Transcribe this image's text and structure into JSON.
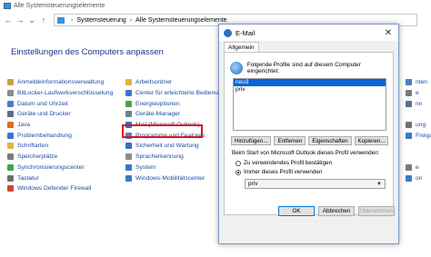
{
  "window": {
    "title": "Alle Systemsteuerungselemente"
  },
  "address": {
    "crumbs": [
      "Systemsteuerung",
      "Alle Systemsteuerungselemente"
    ]
  },
  "heading": "Einstellungen des Computers anpassen",
  "col1": [
    {
      "label": "Anmeldeinformationsverwaltung",
      "color": "#c9a23d"
    },
    {
      "label": "BitLocker-Laufwerkverschlüsselung",
      "color": "#8c8c8c"
    },
    {
      "label": "Datum und Uhrzeit",
      "color": "#4a7fc0"
    },
    {
      "label": "Geräte und Drucker",
      "color": "#5c6f84"
    },
    {
      "label": "Java",
      "color": "#d96f2a"
    },
    {
      "label": "Problembehandlung",
      "color": "#3a78c9"
    },
    {
      "label": "Schriftarten",
      "color": "#e0b640"
    },
    {
      "label": "Speicherplätze",
      "color": "#7a7a7a"
    },
    {
      "label": "Synchronisierungscenter",
      "color": "#3aa64a"
    },
    {
      "label": "Tastatur",
      "color": "#6f6f6f"
    },
    {
      "label": "Windows Defender Firewall",
      "color": "#c94a2a"
    }
  ],
  "col2": [
    {
      "label": "Arbeitsordner",
      "color": "#e0b640"
    },
    {
      "label": "Center für erleichterte Bedienung",
      "color": "#3a78c9"
    },
    {
      "label": "Energieoptionen",
      "color": "#4aa04a"
    },
    {
      "label": "Geräte-Manager",
      "color": "#6f7f90"
    },
    {
      "label": "Mail (Microsoft Outlook)",
      "color": "#2f6fc4"
    },
    {
      "label": "Programme und Features",
      "color": "#5a7fb0"
    },
    {
      "label": "Sicherheit und Wartung",
      "color": "#3a6fb8"
    },
    {
      "label": "Spracherkennung",
      "color": "#8c8c8c"
    },
    {
      "label": "System",
      "color": "#3a78c9"
    },
    {
      "label": "Windows-Mobilitätscenter",
      "color": "#3a78c9"
    }
  ],
  "col3": [
    {
      "label": "nten",
      "color": "#4a7fc0"
    },
    {
      "label": "e",
      "color": "#7a7a7a"
    },
    {
      "label": "nn",
      "color": "#5c6f84"
    },
    {
      "label": "",
      "color": "#ffffff"
    },
    {
      "label": "ung",
      "color": "#6f6f6f"
    },
    {
      "label": "Freigabe",
      "color": "#3a78c9"
    },
    {
      "label": "",
      "color": "#ffffff"
    },
    {
      "label": "",
      "color": "#ffffff"
    },
    {
      "label": "e",
      "color": "#7a7a7a"
    },
    {
      "label": "on",
      "color": "#3a78c9"
    }
  ],
  "dialog": {
    "title": "E-Mail",
    "tab": "Allgemein",
    "profiles_header": "Folgende Profile sind auf diesem Computer eingerichtet:",
    "profiles": [
      "neu3",
      "priv"
    ],
    "selected_profile": "neu3",
    "buttons": [
      "Hinzufügen...",
      "Entfernen",
      "Eigenschaften",
      "Kopieren..."
    ],
    "start_label": "Beim Start von Microsoft Outlook dieses Profil verwenden:",
    "radio1": "Zu verwendendes Profil bestätigen",
    "radio2": "Immer dieses Profil verwenden",
    "radio_selected": 2,
    "select_value": "priv",
    "ok": "OK",
    "cancel": "Abbrechen",
    "apply": "Übernehmen"
  }
}
